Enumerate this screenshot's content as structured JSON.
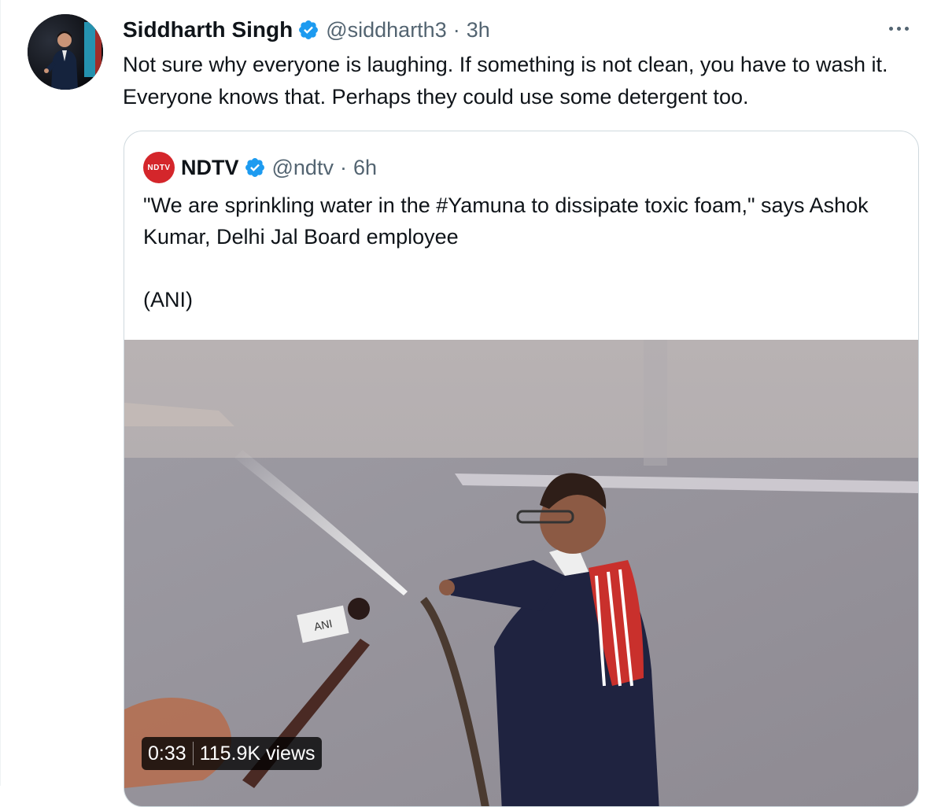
{
  "tweet": {
    "author_name": "Siddharth Singh",
    "author_handle": "@siddharth3",
    "separator": "·",
    "time": "3h",
    "text": "Not sure why everyone is laughing. If something is not clean, you have to wash it. Everyone knows that. Perhaps they could use some detergent too."
  },
  "quoted": {
    "avatar_text": "NDTV",
    "author_name": "NDTV",
    "author_handle": "@ndtv",
    "separator": "·",
    "time": "6h",
    "text_line1": "\"We are sprinkling water in the #Yamuna to dissipate toxic foam,\" says Ashok Kumar, Delhi Jal Board employee",
    "text_line2": "(ANI)"
  },
  "video": {
    "duration": "0:33",
    "views": "115.9K views",
    "mic_flag_text": "ANI"
  },
  "colors": {
    "verified": "#1d9bf0",
    "secondary_text": "#536471",
    "border": "#cfd9de",
    "ndtv_red": "#d4262b"
  }
}
